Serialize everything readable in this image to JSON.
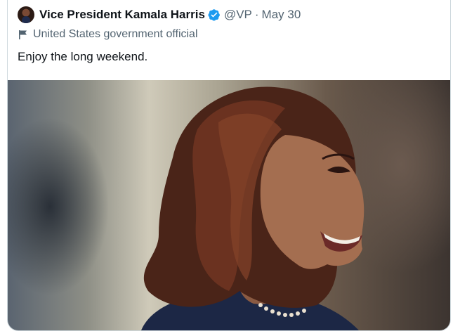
{
  "tweet": {
    "author_name": "Vice President Kamala Harris",
    "handle": "@VP",
    "separator": "·",
    "date": "May 30",
    "account_label": "United States government official",
    "text": "Enjoy the long weekend."
  },
  "colors": {
    "text_primary": "#0f1419",
    "text_secondary": "#536471",
    "verified_blue": "#1d9bf0",
    "border": "#cfd9de"
  },
  "icons": {
    "verified": "verified-badge-icon",
    "label": "flag-icon"
  }
}
